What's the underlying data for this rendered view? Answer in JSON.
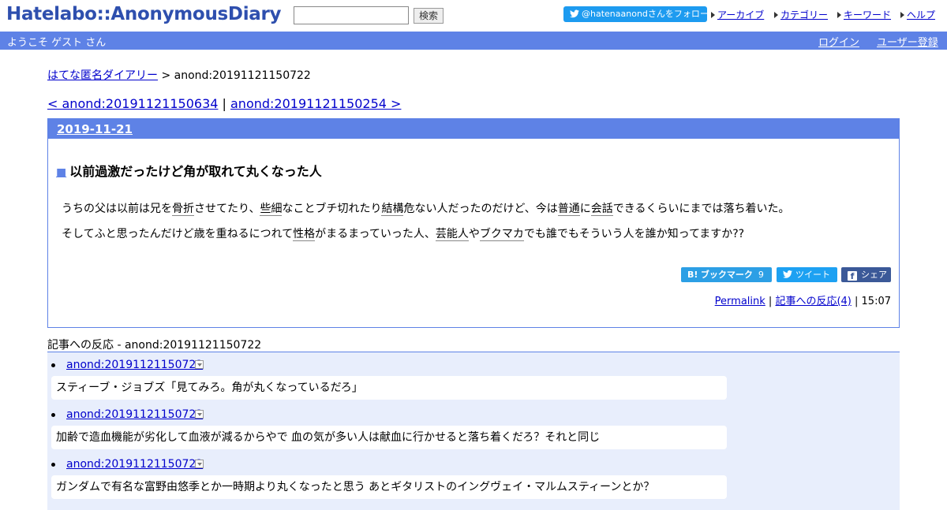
{
  "header": {
    "logo": "Hatelabo::AnonymousDiary",
    "search_button": "検索",
    "follow_button": "@hatenaanondさんをフォロー",
    "nav": [
      {
        "label": "アーカイブ"
      },
      {
        "label": "カテゴリー"
      },
      {
        "label": "キーワード"
      },
      {
        "label": "ヘルプ"
      }
    ]
  },
  "welcome_bar": {
    "text": "ようこそ ゲスト さん",
    "login": "ログイン",
    "register": "ユーザー登録"
  },
  "breadcrumb": {
    "home": "はてな匿名ダイアリー",
    "separator": " > ",
    "current": "anond:20191121150722"
  },
  "pager": {
    "prev": "< anond:20191121150634",
    "separator": " | ",
    "next": "anond:20191121150254 >"
  },
  "entry": {
    "date": "2019-11-21",
    "square": "■",
    "title": "以前過激だったけど角が取れて丸くなった人",
    "paragraph1": {
      "t1": "うちの父は以前は兄を",
      "k1": "骨折",
      "t2": "させてたり、",
      "k2": "些細",
      "t3": "なことブチ切れたり",
      "k3": "結構",
      "t4": "危ない人だったのだけど、今は",
      "k4": "普通",
      "t5": "に",
      "k5": "会話",
      "t6": "できるくらいにまでは落ち着いた。"
    },
    "paragraph2": {
      "t1": "そしてふと思ったんだけど歳を重ねるにつれて",
      "k1": "性格",
      "t2": "がまるまっていった人、",
      "k2": "芸能人",
      "t3": "や",
      "k3": "ブクマカ",
      "t4": "でも誰でもそういう人を誰か知ってますか??"
    },
    "share": {
      "bookmark": "ブックマーク",
      "bookmark_count": "9",
      "tweet": "ツイート",
      "facebook": "シェア"
    },
    "footer": {
      "permalink": "Permalink",
      "sep": " | ",
      "reactions": "記事への反応(4)",
      "time": "15:07"
    }
  },
  "reactions": {
    "title": "記事への反応 - anond:20191121150722",
    "items": [
      {
        "link": "anond:20191121150722",
        "body": "スティーブ・ジョブズ「見てみろ。角が丸くなっているだろ」"
      },
      {
        "link": "anond:20191121150722",
        "body": "加齢で造血機能が劣化して血液が減るからやで 血の気が多い人は献血に行かせると落ち着くだろ？それと同じ"
      },
      {
        "link": "anond:20191121150722",
        "body": "ガンダムで有名な富野由悠季とか一時期より丸くなったと思う あとギタリストのイングヴェイ・マルムスティーンとか？"
      }
    ]
  }
}
